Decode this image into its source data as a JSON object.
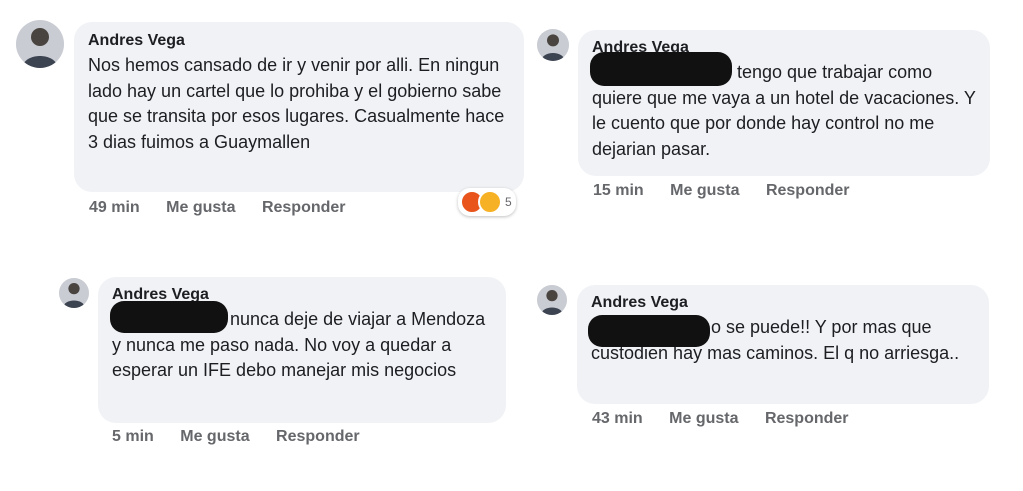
{
  "comments": [
    {
      "author": "Andres Vega",
      "text": "Nos hemos cansado de ir y venir por alli. En ningun lado hay un cartel que lo prohiba y el gobierno sabe que se transita por esos lugares. Casualmente hace 3 dias fuimos a Guaymallen",
      "time": "49 min",
      "like": "Me gusta",
      "reply": "Responder",
      "reactions": {
        "icons": [
          "angry-emoji",
          "haha-emoji"
        ],
        "count": "5"
      }
    },
    {
      "author": "Andres Vega",
      "text": "tengo que trabajar como quiere que me vaya a un hotel de vacaciones. Y le cuento que por donde hay control no me dejarian pasar.",
      "time": "15 min",
      "like": "Me gusta",
      "reply": "Responder"
    },
    {
      "author": "Andres Vega",
      "text": "nunca deje de viajar a Mendoza y nunca me paso nada. No voy a quedar a esperar un IFE debo manejar mis negocios",
      "time": "5 min",
      "like": "Me gusta",
      "reply": "Responder"
    },
    {
      "author": "Andres Vega",
      "text": "o se puede!! Y por mas que custodien hay mas caminos. El q no arriesga..",
      "time": "43 min",
      "like": "Me gusta",
      "reply": "Responder"
    }
  ],
  "colors": {
    "bubble": "#f0f2f5",
    "meta_text": "#65676b",
    "redaction": "#111111"
  }
}
